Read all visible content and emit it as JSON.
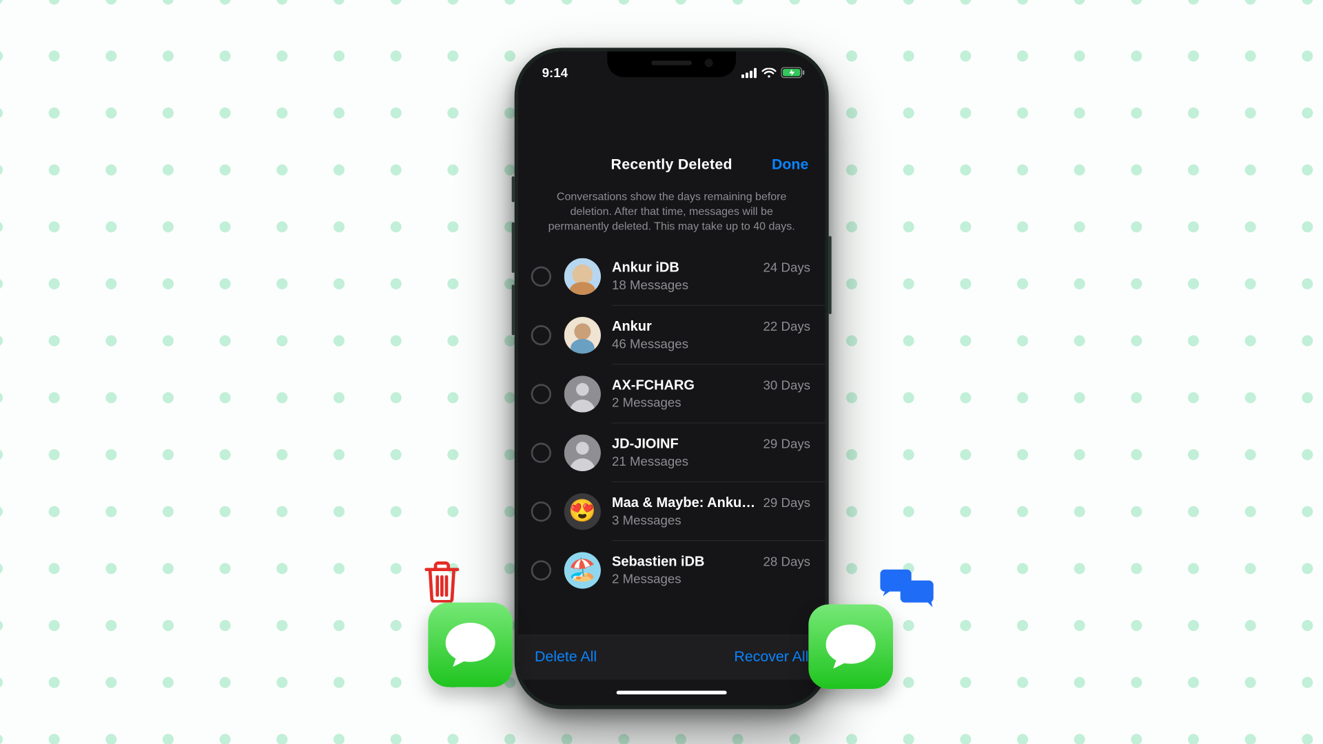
{
  "statusbar": {
    "time": "9:14"
  },
  "nav": {
    "title": "Recently Deleted",
    "done": "Done"
  },
  "subtitle": "Conversations show the days remaining before deletion. After that time, messages will be permanently deleted. This may take up to 40 days.",
  "rows": [
    {
      "name": "Ankur iDB",
      "sub": "18 Messages",
      "days": "24 Days",
      "avatar": "photo-1"
    },
    {
      "name": "Ankur",
      "sub": "46 Messages",
      "days": "22 Days",
      "avatar": "photo-2"
    },
    {
      "name": "AX-FCHARG",
      "sub": "2 Messages",
      "days": "30 Days",
      "avatar": "silhouette"
    },
    {
      "name": "JD-JIOINF",
      "sub": "21 Messages",
      "days": "29 Days",
      "avatar": "silhouette"
    },
    {
      "name": "Maa & Maybe: Ankur...",
      "sub": "3 Messages",
      "days": "29 Days",
      "avatar": "emoji-hearteyes"
    },
    {
      "name": "Sebastien iDB",
      "sub": "2 Messages",
      "days": "28 Days",
      "avatar": "emoji-beach"
    }
  ],
  "toolbar": {
    "delete": "Delete All",
    "recover": "Recover All"
  }
}
